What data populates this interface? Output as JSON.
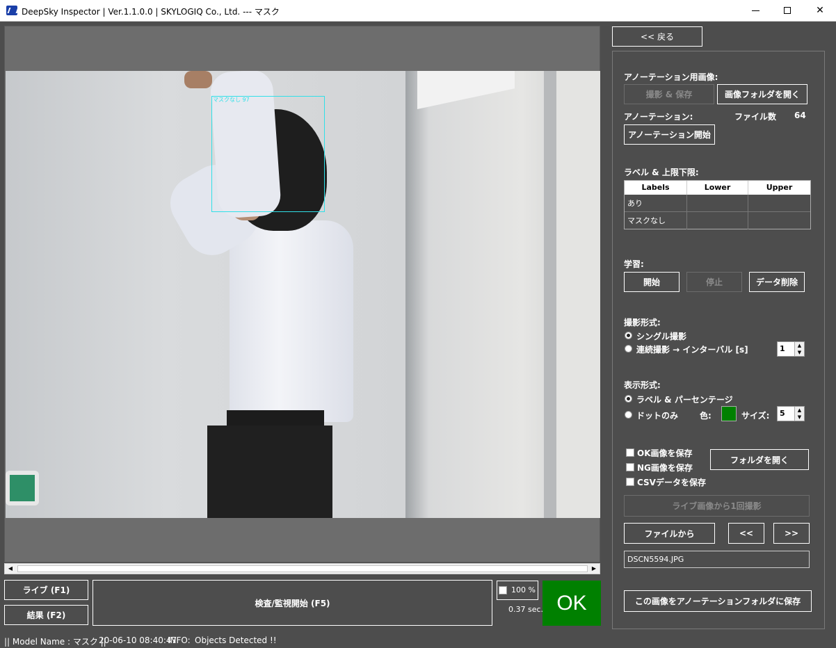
{
  "window": {
    "title": "DeepSky Inspector | Ver.1.1.0.0 | SKYLOGIQ Co., Ltd. --- マスク",
    "minimize": "—",
    "maximize": "☐",
    "close": "✕"
  },
  "viewer": {
    "detection_label": "マスクなし 97"
  },
  "bottom": {
    "live_button": "ライブ (F1)",
    "result_button": "結果 (F2)",
    "inspect_button": "検査/監視開始 (F5)",
    "percent_label": "100 %",
    "elapsed": "0.37 sec.",
    "ok_label": "OK",
    "ok_color": "#008000"
  },
  "status": {
    "model": "|| Model Name : マスク ||",
    "datetime": "20-06-10 08:40:47",
    "info_label": "INFO:",
    "info_text": "Objects Detected !!"
  },
  "panel": {
    "back_button": "<< 戻る",
    "annotation_images_label": "アノーテーション用画像:",
    "capture_save_button": "撮影 & 保存",
    "open_image_folder_button": "画像フォルダを開く",
    "annotation_label": "アノーテーション:",
    "file_count_label": "ファイル数",
    "file_count": "64",
    "start_annotation_button": "アノーテーション開始",
    "labels_limits_label": "ラベル & 上限下限:",
    "table": {
      "headers": [
        "Labels",
        "Lower",
        "Upper"
      ],
      "rows": [
        {
          "label": "あり",
          "lower": "",
          "upper": ""
        },
        {
          "label": "マスクなし",
          "lower": "",
          "upper": ""
        }
      ]
    },
    "learning_label": "学習:",
    "start_button": "開始",
    "stop_button": "停止",
    "delete_data_button": "データ削除",
    "capture_mode_label": "撮影形式:",
    "single_capture": "シングル撮影",
    "continuous_capture": "連続撮影 → インターバル [s]",
    "interval_value": "1",
    "display_mode_label": "表示形式:",
    "label_percentage": "ラベル & パーセンテージ",
    "dots_only": "ドットのみ",
    "color_label": "色:",
    "dot_color": "#008000",
    "size_label": "サイズ:",
    "size_value": "5",
    "save_ok": "OK画像を保存",
    "save_ng": "NG画像を保存",
    "save_csv": "CSVデータを保存",
    "open_folder_button": "フォルダを開く",
    "capture_once_button": "ライブ画像から1回撮影",
    "from_file_button": "ファイルから",
    "prev_button": "<<",
    "next_button": ">>",
    "file_name": "DSCN5594.JPG",
    "save_to_annotation_button": "この画像をアノーテーションフォルダに保存"
  }
}
